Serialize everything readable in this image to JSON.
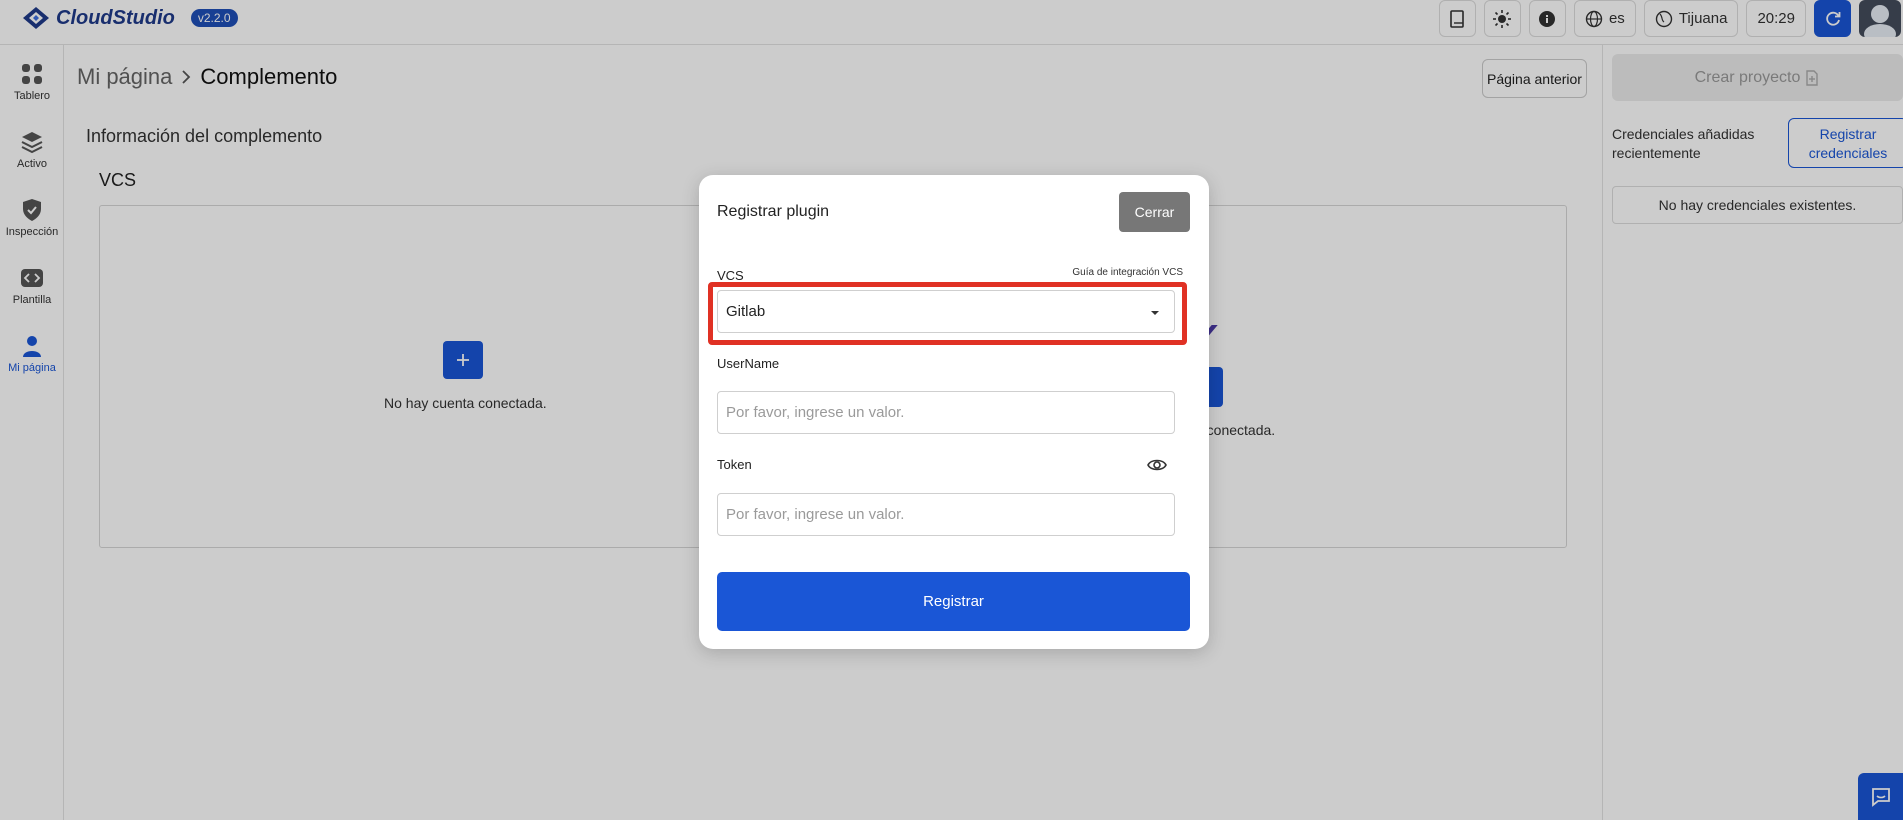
{
  "app": {
    "name": "CloudStudio",
    "version": "v2.2.0"
  },
  "topbar": {
    "language": "es",
    "timezone": "Tijuana",
    "time": "20:29"
  },
  "sidebar": {
    "items": [
      {
        "label": "Tablero",
        "icon": "grid-icon"
      },
      {
        "label": "Activo",
        "icon": "layers-icon"
      },
      {
        "label": "Inspección",
        "icon": "shield-icon"
      },
      {
        "label": "Plantilla",
        "icon": "code-icon"
      },
      {
        "label": "Mi página",
        "icon": "user-icon",
        "active": true
      }
    ]
  },
  "breadcrumb": {
    "parent": "Mi página",
    "current": "Complemento"
  },
  "main": {
    "prev_button": "Página anterior",
    "section_title": "Información del complemento",
    "vcs_title": "VCS",
    "no_account": "No hay cuenta conectada.",
    "no_account_partial": "a conectada."
  },
  "right_panel": {
    "create_project": "Crear proyecto",
    "recent_credentials": "Credenciales añadidas recientemente",
    "register_credentials": "Registrar credenciales",
    "no_credentials": "No hay credenciales existentes."
  },
  "modal": {
    "title": "Registrar plugin",
    "close": "Cerrar",
    "vcs_label": "VCS",
    "guide_link": "Guía de integración VCS",
    "vcs_selected": "Gitlab",
    "username_label": "UserName",
    "username_placeholder": "Por favor, ingrese un valor.",
    "token_label": "Token",
    "token_placeholder": "Por favor, ingrese un valor.",
    "submit": "Registrar"
  },
  "colors": {
    "primary": "#1a56d6",
    "highlight": "#e03124",
    "close_button": "#777777"
  }
}
